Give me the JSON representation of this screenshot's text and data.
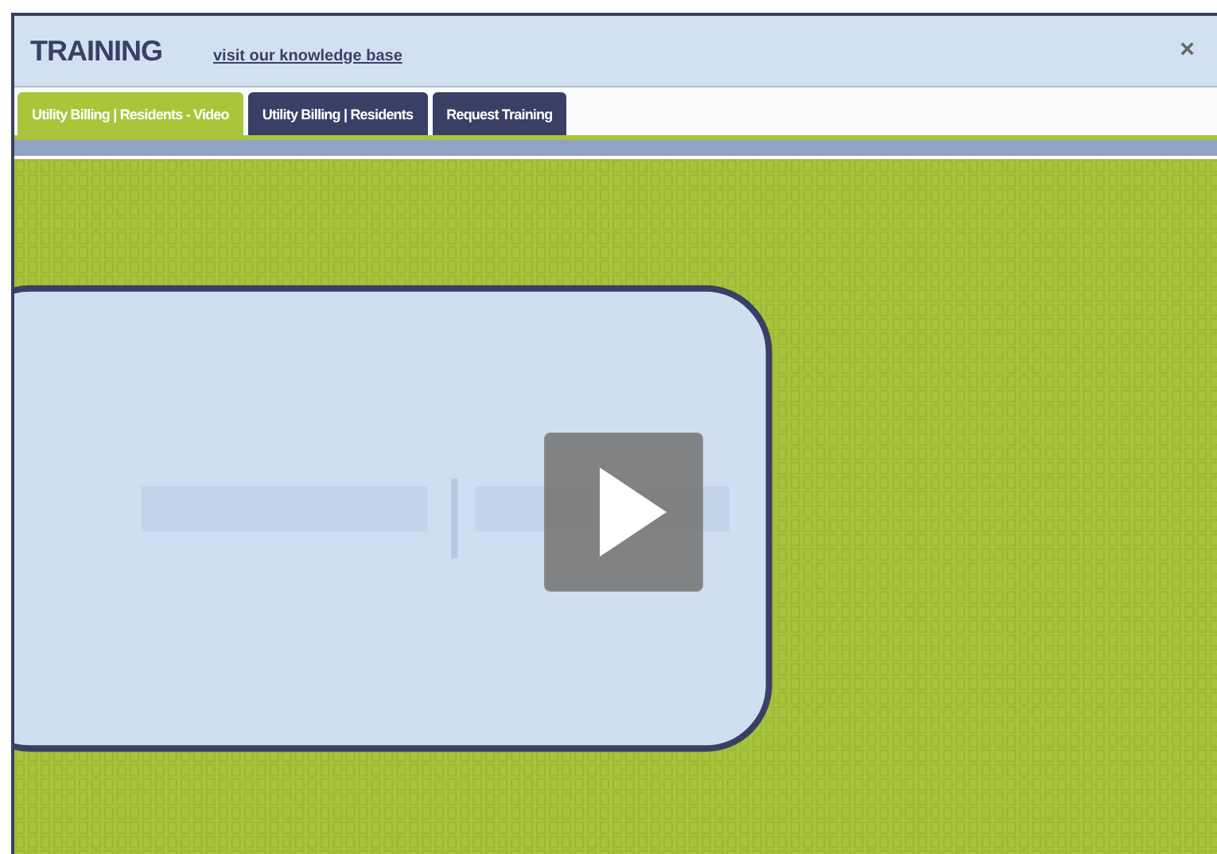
{
  "window": {
    "title": "TRAINING",
    "link": "visit our knowledge base",
    "close": "×"
  },
  "tabs": [
    {
      "label": "Utility Billing | Residents - Video",
      "selected": true
    },
    {
      "label": "Utility Billing | Residents",
      "selected": false
    },
    {
      "label": "Request Training",
      "selected": false
    }
  ]
}
